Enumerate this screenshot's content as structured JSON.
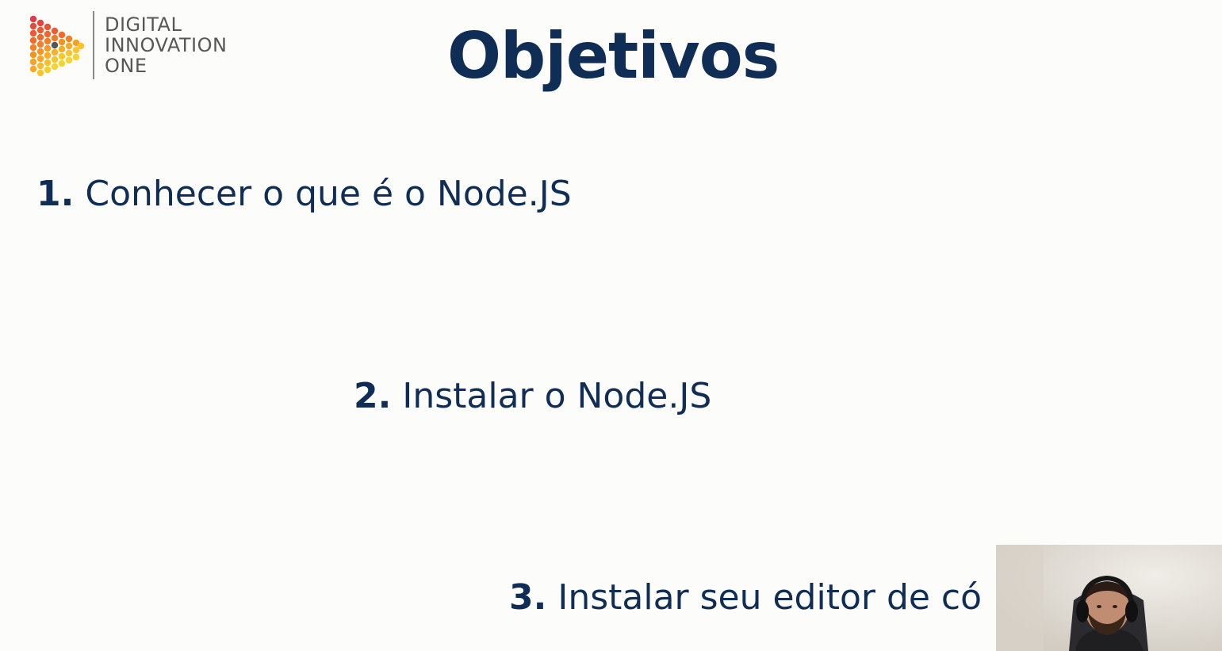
{
  "logo": {
    "lines": [
      "DIGITAL",
      "INNOVATION",
      "ONE"
    ]
  },
  "slide": {
    "title": "Objetivos",
    "items": [
      {
        "number": "1.",
        "text": "Conhecer o que é o Node.JS"
      },
      {
        "number": "2.",
        "text": "Instalar o Node.JS"
      },
      {
        "number": "3.",
        "text": "Instalar seu editor de có"
      }
    ]
  },
  "colors": {
    "title": "#0f2d55",
    "background": "#fcfcfb",
    "logo_text": "#575757",
    "logo_dots": [
      "#e63946",
      "#f26b2a",
      "#f6a21e",
      "#f9d22b"
    ]
  },
  "icons": {
    "logo_mark": "dotted-play-triangle-icon",
    "webcam": "presenter-webcam-video"
  }
}
